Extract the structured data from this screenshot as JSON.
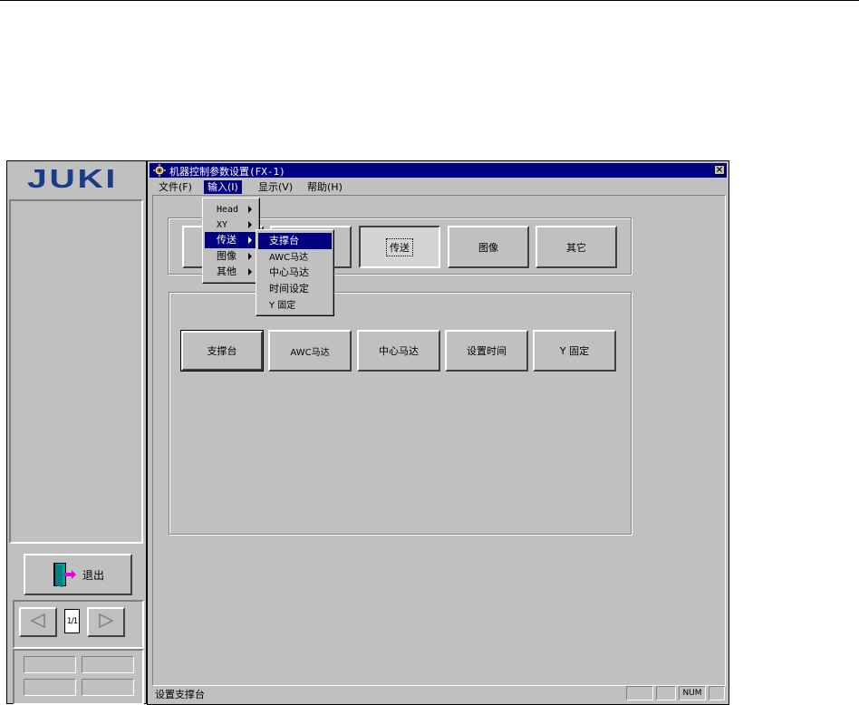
{
  "left_panel": {
    "logo": "JUKI",
    "exit_label": "退出",
    "page_indicator": "1/1"
  },
  "window": {
    "title": "机器控制参数设置(FX-1)",
    "close_symbol": "×",
    "menus": [
      "文件(F)",
      "输入(I)",
      "显示(V)",
      "帮助(H)"
    ],
    "top_buttons": [
      "传送",
      "图像",
      "其它"
    ],
    "sub_buttons": [
      "支撑台",
      "AWC马达",
      "中心马达",
      "设置时间",
      "Y 固定"
    ],
    "status_text": "设置支撑台",
    "status_num": "NUM"
  },
  "input_menu": {
    "items": [
      "Head",
      "XY",
      "传送",
      "图像",
      "其他"
    ]
  },
  "transfer_submenu": {
    "items": [
      "支撑台",
      "AWC马达",
      "中心马达",
      "时间设定",
      "Y 固定"
    ]
  }
}
